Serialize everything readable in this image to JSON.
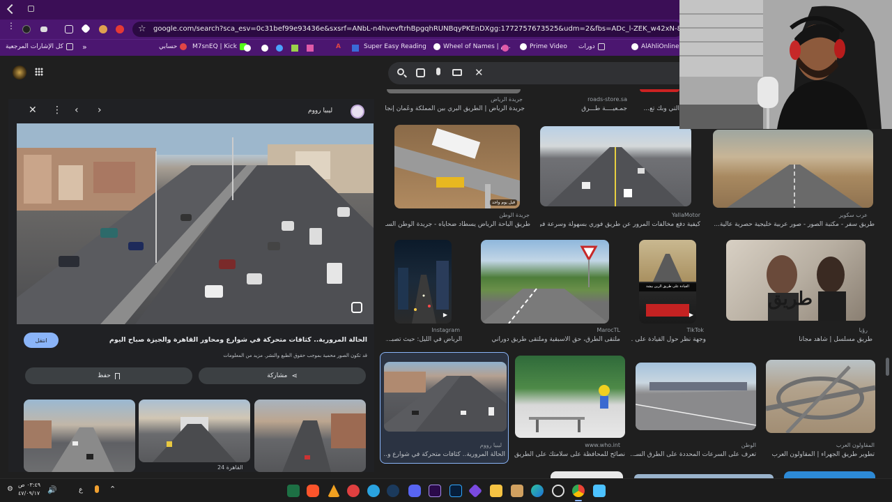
{
  "browser": {
    "url": "google.com/search?sca_esv=0c31bef99e93436e&sxsrf=ANbL-n4hvevftrhBpgqhRUNBqyPKEnDXgg:1772757673525&udm=2&fbs=ADc_l-ZEK_w42xN-8FKZXIh5Vv898t88gy5OKdnJO0yR",
    "bookmarks": [
      {
        "label": "كل الإشارات المرجعية",
        "color": "#f0e6f6"
      },
      {
        "label": "حسابي",
        "color": "#e04646"
      },
      {
        "label": "M7snEQ | Kick",
        "color": "#53fc18"
      },
      {
        "label": "",
        "color": "#ffffff"
      },
      {
        "label": "",
        "color": "#4aa3ff"
      },
      {
        "label": "",
        "color": "#9ad14b"
      },
      {
        "label": "",
        "color": "#e05aa8"
      },
      {
        "label": "",
        "color": "#e04646"
      },
      {
        "label": "Super Easy Reading",
        "color": "#3a6bd8"
      },
      {
        "label": "Wheel of Names | م...",
        "color": "#ffffff"
      },
      {
        "label": "Prime Video",
        "color": "#ffffff"
      },
      {
        "label": "دورات",
        "color": "#f0e6f6"
      },
      {
        "label": "AlAhliOnline",
        "color": "#ffffff"
      }
    ]
  },
  "preview": {
    "source_name": "ليبيا رووم",
    "title": "الحالة المرورية.. كثافات متحركة في شوارع ومحاور القاهرة والجيزة صباح اليوم",
    "visit_label": "انتقل",
    "copyright_note": "قد تكون الصور محمية بموجب حقوق الطبع والنشر. مزيد من المعلومات",
    "share_label": "مشاركة",
    "save_label": "حفظ",
    "related_caption": "القاهرة 24"
  },
  "grid": {
    "row0": [
      {
        "source": "جريدة الرياض",
        "caption": "جريدة الرياض | الطريق البري بين المملكة وعُمان إنجا..."
      },
      {
        "source": "roads-store.sa",
        "caption": "جمـعيــــة طُـــرق"
      },
      {
        "source": "",
        "caption": "التي وبك تع..."
      }
    ],
    "row1": [
      {
        "source": "جريدة الوطن",
        "caption": "طريق الباحة الرياض يسطاد ضحاياه - جريدة الوطن السـ...",
        "overlay": "قبل يوم واحد"
      },
      {
        "source": "YallaMotor",
        "caption": "كيفية دفع مخالفات المرور عن طريق فوري بسهولة وسرعة في ..."
      },
      {
        "source": "عرب سكوير",
        "caption": "طريق سفر - مكتبة الصور - صور عربية خليجية حصرية عالية..."
      }
    ],
    "row2": [
      {
        "source": "Instagram",
        "caption": "الرياض في الليل: حيث تصبـ..."
      },
      {
        "source": "MarocTL",
        "caption": "ملتقى الطرق، حق الأسبقية وملتقى طريق دوراني"
      },
      {
        "source": "TikTok",
        "caption": "وجهة نظر حول القيادة على ...",
        "overlay": "القيادة على طريق الرين بيشة"
      },
      {
        "source": "رؤيا",
        "caption": "طريق مسلسل | شاهد مجاناً",
        "poster_title": "طريق"
      }
    ],
    "row3": [
      {
        "source": "ليبيا رووم",
        "caption": "الحالة المرورية.. كثافات متحركة في شوارع و..."
      },
      {
        "source": "www.who.int",
        "caption": "نصائح للمحافظة على سلامتك على الطريق"
      },
      {
        "source": "الوطن",
        "caption": "تعرف على السرعات المحددة على الطرق السـ..."
      },
      {
        "source": "المقاولون العرب",
        "caption": "تطوير طريق الجهراء | المقاولون العرب"
      }
    ]
  },
  "taskbar": {
    "time": "٠٣:٤٩ ص",
    "date": "٤٧/٠٩/١٧",
    "lang": "ع"
  },
  "colors": {
    "tabbar": "#3b0e56",
    "toolbar": "#4b1670",
    "page_bg": "#1f1f1f",
    "accent": "#8ab4f8"
  }
}
